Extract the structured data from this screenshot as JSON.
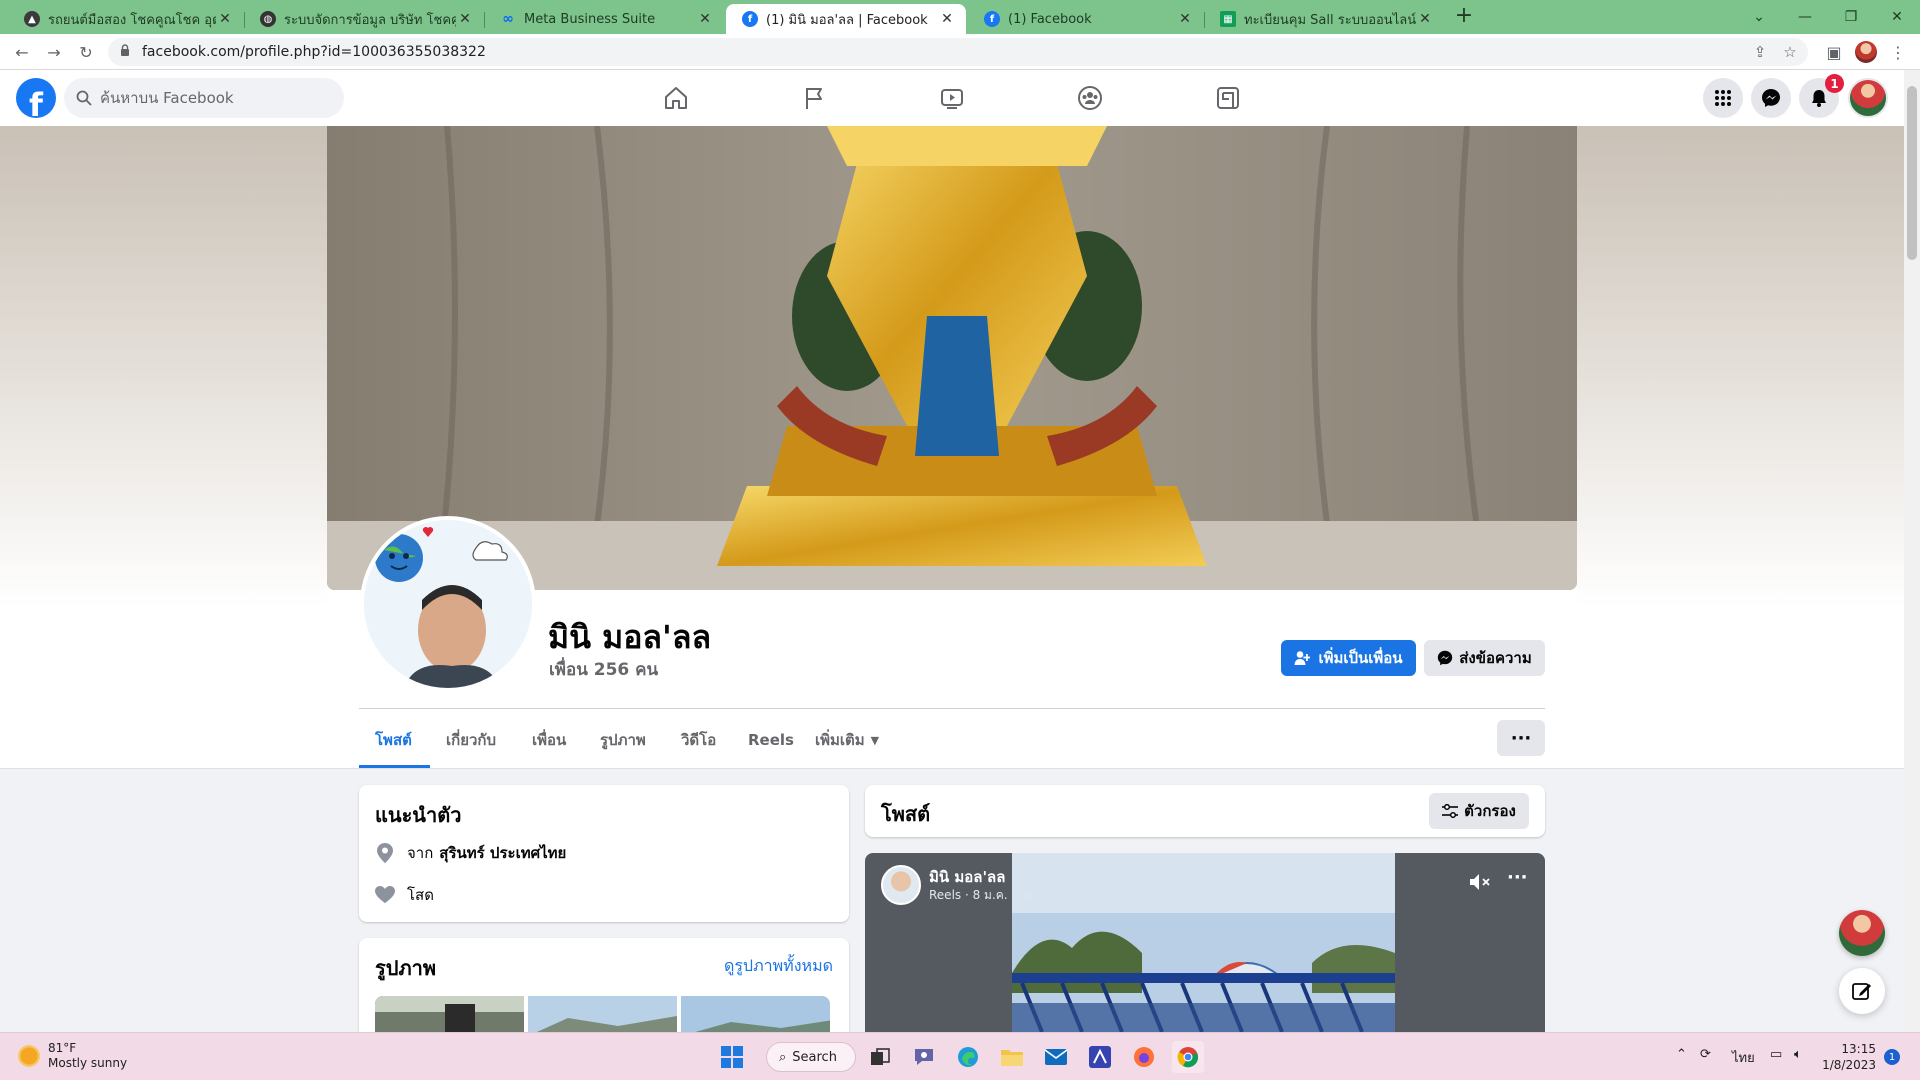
{
  "browser": {
    "tabs": [
      {
        "title": "รถยนต์มือสอง โชคคูณโชค อุดรธานี",
        "favicon": "car-dealer-icon",
        "fav_color": "#3b3b3b"
      },
      {
        "title": "ระบบจัดการข้อมูล บริษัท โชคคูณโชค",
        "favicon": "globe-icon",
        "fav_color": "#333333"
      },
      {
        "title": "Meta Business Suite",
        "favicon": "meta-icon",
        "fav_color": "#0866ff"
      },
      {
        "title": "(1) มินิ มอล'ลล | Facebook",
        "favicon": "facebook-icon",
        "fav_color": "#1877f2"
      },
      {
        "title": "(1) Facebook",
        "favicon": "facebook-icon",
        "fav_color": "#1877f2"
      },
      {
        "title": "ทะเบียนคุม Sall ระบบออนไลน์.xlsx - G",
        "favicon": "sheets-icon",
        "fav_color": "#0f9d58"
      }
    ],
    "url": "facebook.com/profile.php?id=100036355038322"
  },
  "fb": {
    "search_placeholder": "ค้นหาบน Facebook",
    "notifications_count": "1",
    "colors": {
      "brand": "#1877f2",
      "primary_button": "#1b74e4",
      "badge": "#e41e3f"
    }
  },
  "profile": {
    "name": "มินิ มอล'ลล",
    "friends": "เพื่อน 256 คน",
    "add_friend_label": "เพิ่มเป็นเพื่อน",
    "message_label": "ส่งข้อความ",
    "tabs": [
      "โพสต์",
      "เกี่ยวกับ",
      "เพื่อน",
      "รูปภาพ",
      "วิดีโอ",
      "Reels",
      "เพิ่มเติม"
    ],
    "active_tab": "โพสต์"
  },
  "intro": {
    "title": "แนะนำตัว",
    "from_prefix": "จาก",
    "from_place": "สุรินทร์ ประเทศไทย",
    "relationship": "โสด"
  },
  "photos": {
    "title": "รูปภาพ",
    "see_all": "ดูรูปภาพทั้งหมด"
  },
  "posts": {
    "title": "โพสต์",
    "filter_label": "ตัวกรอง",
    "reel": {
      "author": "มินิ มอล'ลล",
      "meta": "Reels · 8 ม.ค. ·"
    }
  },
  "taskbar": {
    "temperature": "81°F",
    "weather": "Mostly sunny",
    "search_label": "Search",
    "language": "ไทย",
    "time": "13:15",
    "date": "1/8/2023",
    "notification_count": "1"
  }
}
